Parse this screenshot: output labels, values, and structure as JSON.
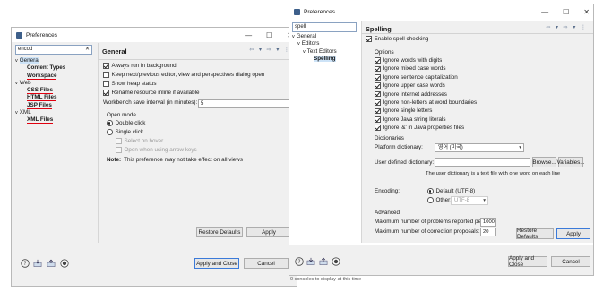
{
  "left_dialog": {
    "title": "Preferences",
    "window_controls": [
      "—",
      "☐",
      "✕"
    ],
    "filter_value": "encod",
    "filter_clear": "✕",
    "tree": [
      {
        "label": "General",
        "level": 0,
        "expander": "v",
        "selected": true
      },
      {
        "label": "Content Types",
        "level": 1,
        "bold": true
      },
      {
        "label": "Workspace",
        "level": 1,
        "bold": true,
        "underlined": true
      },
      {
        "label": "Web",
        "level": 0,
        "expander": "v"
      },
      {
        "label": "CSS Files",
        "level": 1,
        "bold": true,
        "underlined": true
      },
      {
        "label": "HTML Files",
        "level": 1,
        "bold": true,
        "underlined": true
      },
      {
        "label": "JSP Files",
        "level": 1,
        "bold": true,
        "underlined": true
      },
      {
        "label": "XML",
        "level": 0,
        "expander": "v"
      },
      {
        "label": "XML Files",
        "level": 1,
        "bold": true,
        "underlined": true
      }
    ],
    "page_title": "General",
    "nav_arrows": "⇦ ▾ ⇨ ▾ ⋮",
    "options": {
      "always_run_bg": {
        "label": "Always run in background",
        "checked": true
      },
      "keep_next_prev": {
        "label": "Keep next/previous editor, view and perspectives dialog open",
        "checked": false
      },
      "show_heap": {
        "label": "Show heap status",
        "checked": false
      },
      "rename_inline": {
        "label": "Rename resource inline if available",
        "checked": true
      }
    },
    "save_interval_label": "Workbench save interval (in minutes):",
    "save_interval_value": "5",
    "open_mode": {
      "title": "Open mode",
      "double_click": "Double click",
      "single_click": "Single click",
      "select_on_hover": "Select on hover",
      "open_when_arrow": "Open when using arrow keys",
      "selected": "double_click"
    },
    "note_bold": "Note:",
    "note_text": "This preference may not take effect on all views",
    "restore_defaults": "Restore Defaults",
    "apply": "Apply",
    "apply_and_close": "Apply and Close",
    "cancel": "Cancel"
  },
  "right_dialog": {
    "title": "Preferences",
    "window_controls": [
      "—",
      "☐",
      "✕"
    ],
    "filter_value": "spell",
    "tree": [
      {
        "label": "General",
        "level": 0,
        "expander": "v"
      },
      {
        "label": "Editors",
        "level": 1,
        "expander": "v"
      },
      {
        "label": "Text Editors",
        "level": 2,
        "expander": "v"
      },
      {
        "label": "Spelling",
        "level": 3,
        "bold": true,
        "selected": true
      }
    ],
    "page_title": "Spelling",
    "nav_arrows": "⇦ ▾ ⇨ ▾ ⋮",
    "enable_spell": {
      "label": "Enable spell checking",
      "checked": true
    },
    "options_title": "Options",
    "options": [
      {
        "label": "Ignore words with digits",
        "checked": true
      },
      {
        "label": "Ignore mixed case words",
        "checked": true
      },
      {
        "label": "Ignore sentence capitalization",
        "checked": true
      },
      {
        "label": "Ignore upper case words",
        "checked": true
      },
      {
        "label": "Ignore internet addresses",
        "checked": true
      },
      {
        "label": "Ignore non-letters at word boundaries",
        "checked": true
      },
      {
        "label": "Ignore single letters",
        "checked": true
      },
      {
        "label": "Ignore Java string literals",
        "checked": true
      },
      {
        "label": "Ignore '&' in Java properties files",
        "checked": true
      }
    ],
    "dictionaries_title": "Dictionaries",
    "platform_dict_label": "Platform dictionary:",
    "platform_dict_value": "영어 (미국)",
    "user_dict_label": "User defined dictionary:",
    "user_dict_value": "",
    "browse": "Browse...",
    "variables": "Variables...",
    "user_dict_note": "The user dictionary is a text file with one word on each line",
    "encoding_label": "Encoding:",
    "encoding_default": "Default (UTF-8)",
    "encoding_other": "Other:",
    "encoding_other_value": "UTF-8",
    "encoding_selected": "default",
    "advanced_title": "Advanced",
    "max_problems_label": "Maximum number of problems reported per file:",
    "max_problems_value": "1000",
    "max_corrections_label": "Maximum number of correction proposals:",
    "max_corrections_value": "20",
    "restore_defaults": "Restore Defaults",
    "apply": "Apply",
    "apply_and_close": "Apply and Close",
    "cancel": "Cancel",
    "status_text": "0 consoles to display at this time"
  },
  "bottom_icons": [
    "help-icon",
    "import-icon",
    "export-icon",
    "record-icon"
  ]
}
